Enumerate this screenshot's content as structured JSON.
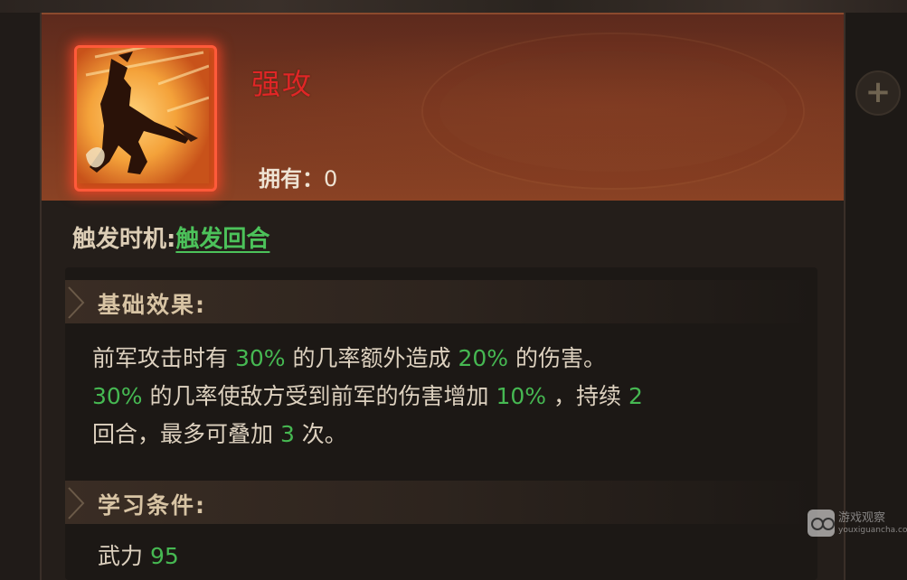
{
  "skill": {
    "name": "强攻",
    "owned_label": "拥有：",
    "owned_value": "0",
    "icon": "warrior-slash-icon"
  },
  "trigger": {
    "label": "触发时机:",
    "value": "触发回合"
  },
  "basic_effect": {
    "title": "基础效果:",
    "line1": {
      "t1": "前军攻击时有 ",
      "n1": "30%",
      "t2": " 的几率额外造成 ",
      "n2": "20%",
      "t3": " 的伤害。"
    },
    "line2": {
      "n1": "30%",
      "t1": " 的几率使敌方受到前军的伤害增加 ",
      "n2": "10%",
      "t2": " ，持续 ",
      "n3": "2"
    },
    "line3": {
      "t1": "回合，最多可叠加 ",
      "n1": "3",
      "t2": " 次。"
    }
  },
  "learn_condition": {
    "title": "学习条件:",
    "attribute": "武力",
    "value": "95"
  },
  "side": {
    "plus_icon": "plus-icon"
  },
  "watermark": {
    "line1": "游戏观察",
    "line2": "youxiguancha.com"
  },
  "colors": {
    "skill_name": "#e02626",
    "highlight_number": "#46b852",
    "icon_glow": "#ff5a3a"
  }
}
